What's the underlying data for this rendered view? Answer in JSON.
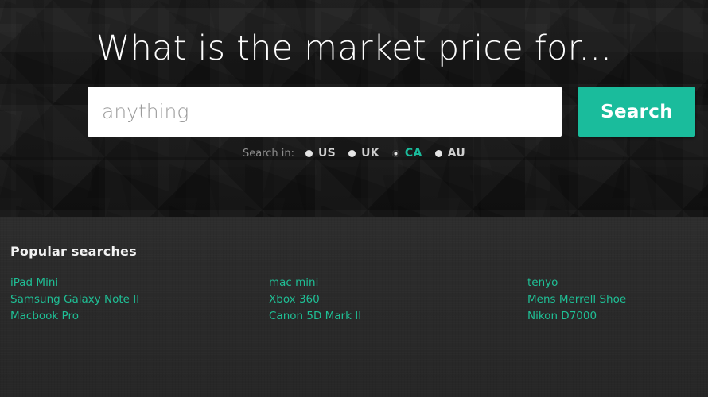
{
  "hero": {
    "title": "What is the market price for...",
    "search": {
      "placeholder": "anything",
      "value": "",
      "button_label": "Search"
    },
    "country_picker": {
      "label": "Search in:",
      "selected": "CA",
      "options": [
        {
          "code": "US",
          "selected": false
        },
        {
          "code": "UK",
          "selected": false
        },
        {
          "code": "CA",
          "selected": true
        },
        {
          "code": "AU",
          "selected": false
        }
      ]
    }
  },
  "popular": {
    "title": "Popular searches",
    "columns": [
      {
        "items": [
          "iPad Mini",
          "Samsung Galaxy Note II",
          "Macbook Pro"
        ]
      },
      {
        "items": [
          "mac mini",
          "Xbox 360",
          "Canon 5D Mark II"
        ]
      },
      {
        "items": [
          "tenyo",
          "Mens Merrell Shoe",
          "Nikon D7000"
        ]
      }
    ]
  },
  "colors": {
    "accent": "#1abc9c",
    "link": "#1fbf95",
    "hero_bg": "#191919",
    "popular_bg": "#2b2b2b",
    "heading": "#fdfdfd",
    "placeholder": "#9b9b9b"
  }
}
